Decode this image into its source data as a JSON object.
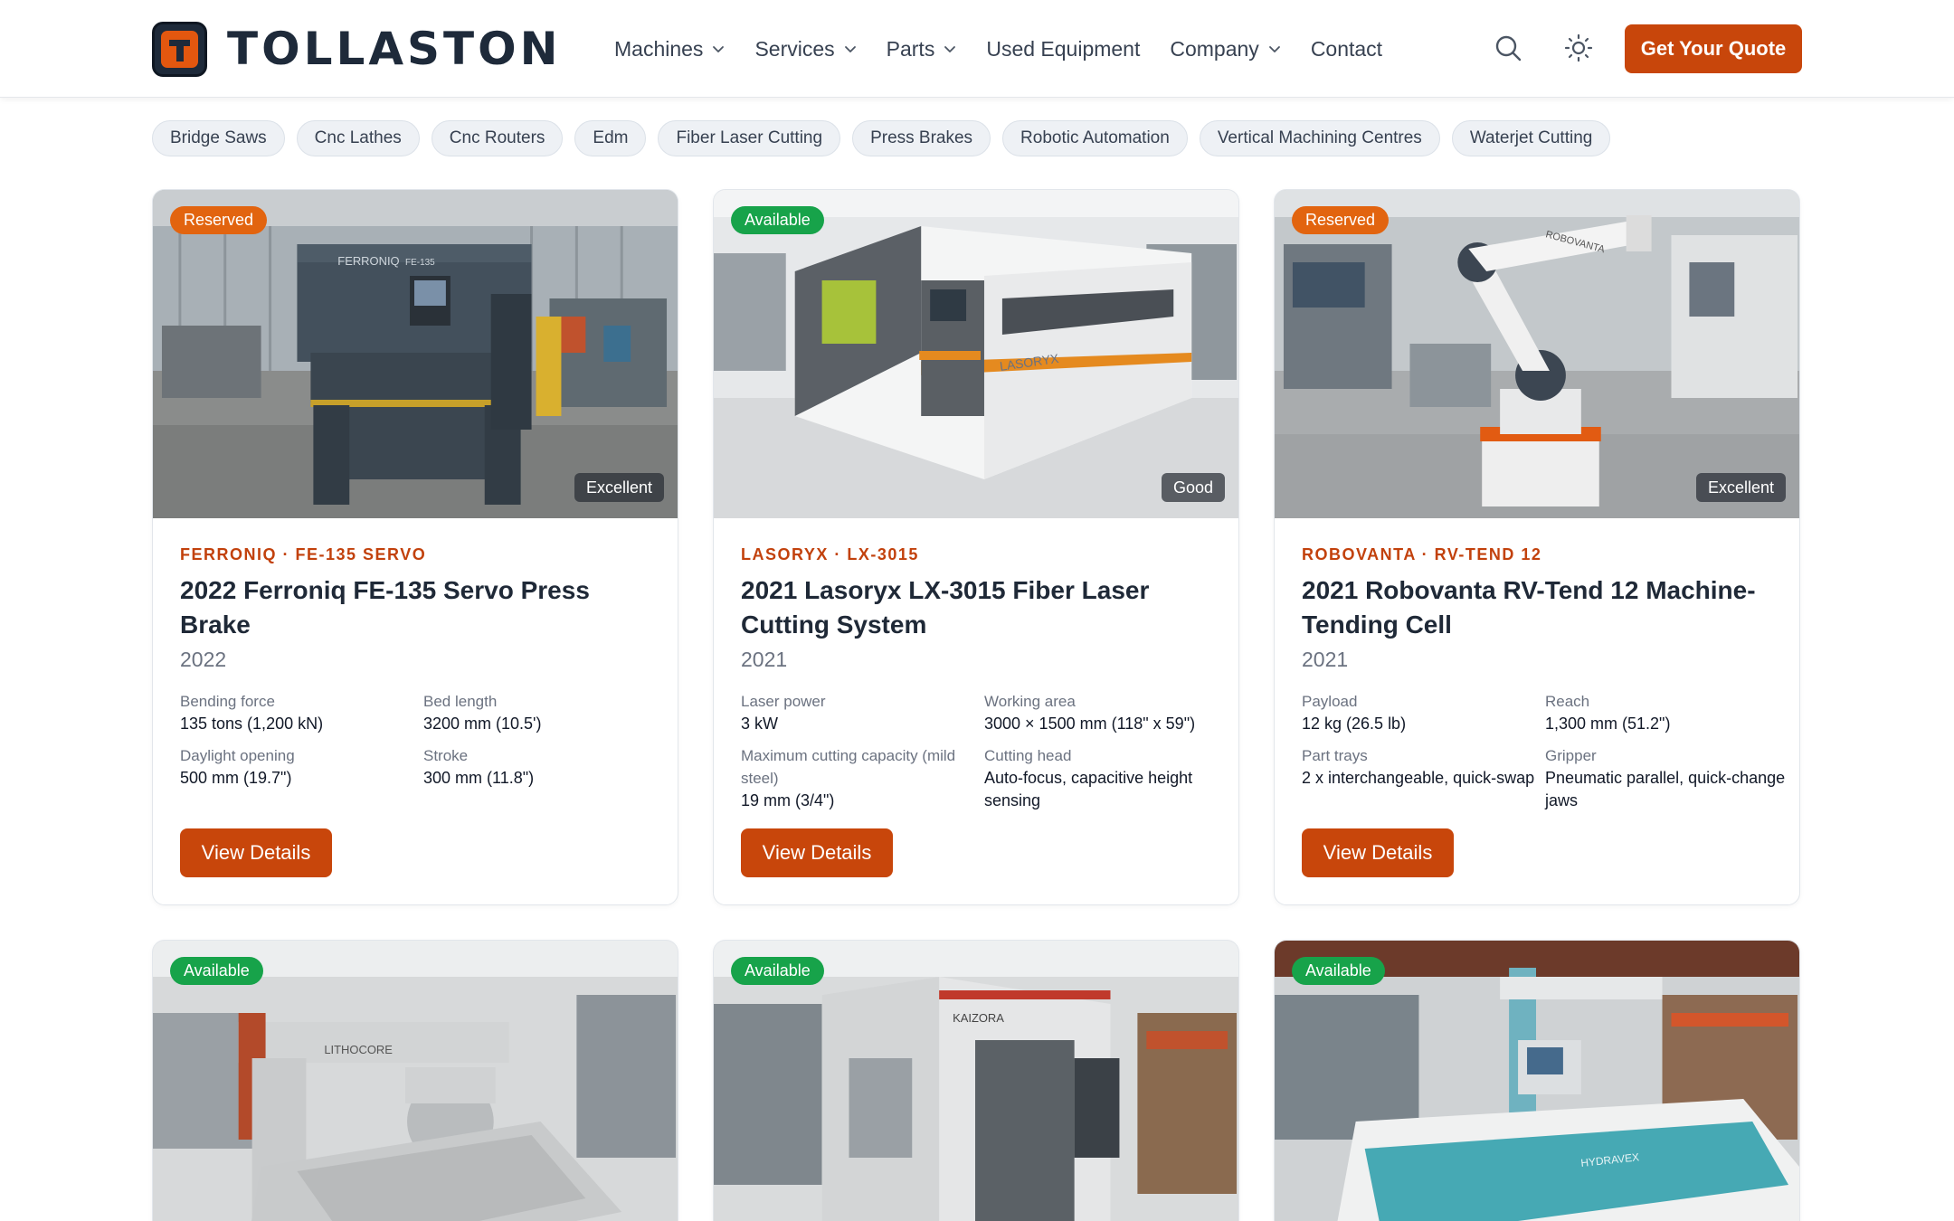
{
  "brand": {
    "name": "TOLLASTON"
  },
  "nav": {
    "items": [
      {
        "label": "Machines",
        "dropdown": true
      },
      {
        "label": "Services",
        "dropdown": true
      },
      {
        "label": "Parts",
        "dropdown": true
      },
      {
        "label": "Used Equipment",
        "dropdown": false
      },
      {
        "label": "Company",
        "dropdown": true
      },
      {
        "label": "Contact",
        "dropdown": false
      }
    ],
    "search_icon": "search-icon",
    "theme_icon": "sun-icon",
    "cta_label": "Get Your Quote"
  },
  "categories": [
    "Bridge Saws",
    "Cnc Lathes",
    "Cnc Routers",
    "Edm",
    "Fiber Laser Cutting",
    "Press Brakes",
    "Robotic Automation",
    "Vertical Machining Centres",
    "Waterjet Cutting"
  ],
  "colors": {
    "accent": "#c8460b",
    "reserved": "#e2640f",
    "available": "#17a34a",
    "navy": "#1e2a3a"
  },
  "listings": [
    {
      "status": "Reserved",
      "condition": "Excellent",
      "brand_line": "FERRONIQ · FE-135 SERVO",
      "title": "2022 Ferroniq FE-135 Servo Press Brake",
      "year": "2022",
      "specs": [
        {
          "label": "Bending force",
          "value": "135 tons (1,200 kN)"
        },
        {
          "label": "Bed length",
          "value": "3200 mm (10.5')"
        },
        {
          "label": "Daylight opening",
          "value": "500 mm (19.7\")"
        },
        {
          "label": "Stroke",
          "value": "300 mm (11.8\")"
        }
      ],
      "button": "View Details"
    },
    {
      "status": "Available",
      "condition": "Good",
      "brand_line": "LASORYX · LX-3015",
      "title": "2021 Lasoryx LX-3015 Fiber Laser Cutting System",
      "year": "2021",
      "specs": [
        {
          "label": "Laser power",
          "value": "3 kW"
        },
        {
          "label": "Working area",
          "value": "3000 × 1500 mm (118\" x 59\")"
        },
        {
          "label": "Maximum cutting capacity (mild steel)",
          "value": "19 mm (3/4\")"
        },
        {
          "label": "Cutting head",
          "value": "Auto-focus, capacitive height sensing"
        }
      ],
      "button": "View Details"
    },
    {
      "status": "Reserved",
      "condition": "Excellent",
      "brand_line": "ROBOVANTA · RV-TEND 12",
      "title": "2021 Robovanta RV-Tend 12 Machine-Tending Cell",
      "year": "2021",
      "specs": [
        {
          "label": "Payload",
          "value": "12 kg (26.5 lb)"
        },
        {
          "label": "Reach",
          "value": "1,300 mm (51.2\")"
        },
        {
          "label": "Part trays",
          "value": "2 x interchangeable, quick-swap"
        },
        {
          "label": "Gripper",
          "value": "Pneumatic parallel, quick-change jaws"
        }
      ],
      "button": "View Details"
    },
    {
      "status": "Available",
      "photo_label": "LITHOCORE"
    },
    {
      "status": "Available",
      "photo_label": "KAIZORA"
    },
    {
      "status": "Available",
      "photo_label": "HYDRAVEX"
    }
  ],
  "photo_labels": {
    "card0": "FERRONIQ",
    "card0_model": "FE-135",
    "card1": "LASORYX",
    "card2": "ROBOVANTA"
  }
}
